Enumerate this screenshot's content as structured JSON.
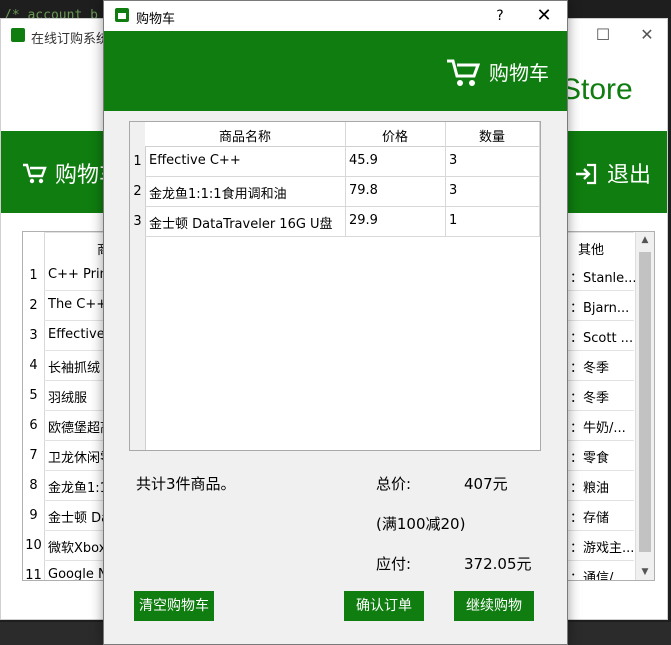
{
  "editor_snippet": "/* account_b",
  "main_window": {
    "title": "在线订购系统",
    "brand": "Store",
    "nav": {
      "cart": "购物车",
      "exit": "退出"
    },
    "table": {
      "headers": {
        "name": "商",
        "other": "其他"
      },
      "rows": [
        {
          "num": "1",
          "name": "C++ Prim",
          "other": "：Stanle..."
        },
        {
          "num": "2",
          "name": "The C++",
          "other": "：Bjarn..."
        },
        {
          "num": "3",
          "name": "Effective C",
          "other": "：Scott ..."
        },
        {
          "num": "4",
          "name": "长袖抓绒",
          "other": "：冬季"
        },
        {
          "num": "5",
          "name": "羽绒服",
          "other": "：冬季"
        },
        {
          "num": "6",
          "name": "欧德堡超高",
          "other": "：牛奶/..."
        },
        {
          "num": "7",
          "name": "卫龙休闲零",
          "other": "：零食"
        },
        {
          "num": "8",
          "name": "金龙鱼1:1",
          "other": "：粮油"
        },
        {
          "num": "9",
          "name": "金士顿 Da",
          "other": "：存储"
        },
        {
          "num": "10",
          "name": "微软Xbox",
          "other": "：游戏主..."
        },
        {
          "num": "11",
          "name": "Google N",
          "other": "：通信/..."
        }
      ]
    }
  },
  "dialog": {
    "title": "购物车",
    "help": "?",
    "close": "✕",
    "header": "购物车",
    "table": {
      "headers": {
        "name": "商品名称",
        "price": "价格",
        "qty": "数量"
      },
      "rows": [
        {
          "num": "1",
          "name": "Effective C++",
          "price": "45.9",
          "qty": "3"
        },
        {
          "num": "2",
          "name": "金龙鱼1:1:1食用调和油",
          "price": "79.8",
          "qty": "3"
        },
        {
          "num": "3",
          "name": "金士顿 DataTraveler 16G U盘",
          "price": "29.9",
          "qty": "1"
        }
      ]
    },
    "summary": {
      "count_text": "共计3件商品。",
      "total_label": "总价:",
      "total_value": "407元",
      "discount": "(满100减20)",
      "payable_label": "应付:",
      "payable_value": "372.05元"
    },
    "buttons": {
      "clear": "清空购物车",
      "confirm": "确认订单",
      "continue": "继续购物"
    }
  },
  "colors": {
    "accent": "#0f7d0f"
  }
}
